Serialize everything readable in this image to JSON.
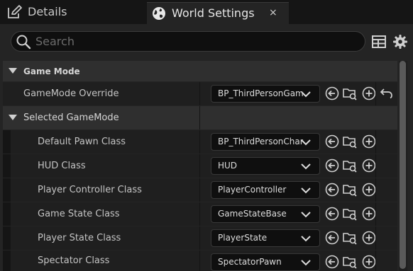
{
  "tabs": {
    "details": {
      "label": "Details",
      "icon": "pencil-icon"
    },
    "world_settings": {
      "label": "World Settings",
      "icon": "globe-icon",
      "close": "×"
    }
  },
  "search": {
    "placeholder": "Search",
    "value": ""
  },
  "categories": {
    "game_mode": "Game Mode",
    "selected_game_mode": "Selected GameMode"
  },
  "properties": {
    "gamemode_override": {
      "label": "GameMode Override",
      "value": "BP_ThirdPersonGameMode"
    },
    "default_pawn_class": {
      "label": "Default Pawn Class",
      "value": "BP_ThirdPersonCharacter"
    },
    "hud_class": {
      "label": "HUD Class",
      "value": "HUD"
    },
    "player_controller_class": {
      "label": "Player Controller Class",
      "value": "PlayerController"
    },
    "game_state_class": {
      "label": "Game State Class",
      "value": "GameStateBase"
    },
    "player_state_class": {
      "label": "Player State Class",
      "value": "PlayerState"
    },
    "spectator_class": {
      "label": "Spectator Class",
      "value": "SpectatorPawn"
    }
  },
  "colors": {
    "panel": "#242424",
    "category_row": "#2f2f2f",
    "property_row": "#1f1f1f",
    "combo_bg": "#0f0f0f"
  }
}
